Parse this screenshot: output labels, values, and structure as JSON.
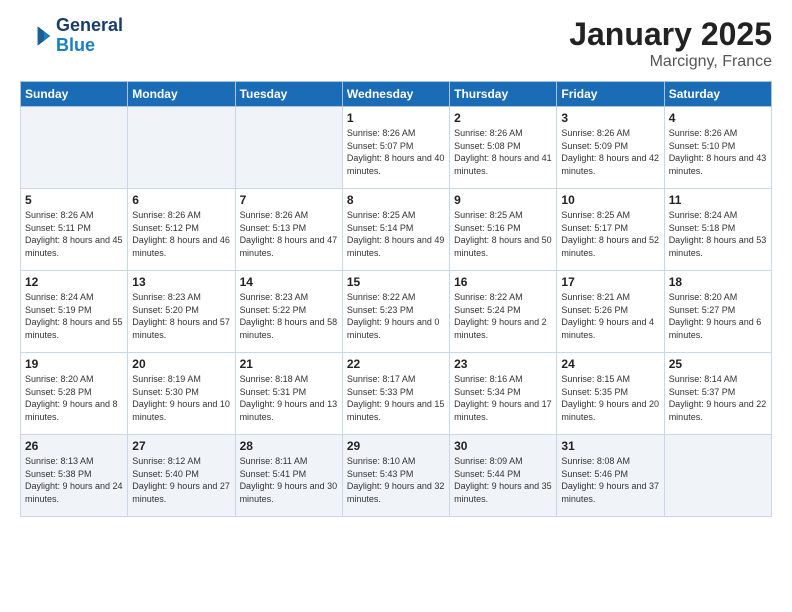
{
  "header": {
    "logo": {
      "line1": "General",
      "line2": "Blue"
    },
    "title": "January 2025",
    "location": "Marcigny, France"
  },
  "weekdays": [
    "Sunday",
    "Monday",
    "Tuesday",
    "Wednesday",
    "Thursday",
    "Friday",
    "Saturday"
  ],
  "weeks": [
    [
      {
        "day": "",
        "sunrise": "",
        "sunset": "",
        "daylight": ""
      },
      {
        "day": "",
        "sunrise": "",
        "sunset": "",
        "daylight": ""
      },
      {
        "day": "",
        "sunrise": "",
        "sunset": "",
        "daylight": ""
      },
      {
        "day": "1",
        "sunrise": "Sunrise: 8:26 AM",
        "sunset": "Sunset: 5:07 PM",
        "daylight": "Daylight: 8 hours and 40 minutes."
      },
      {
        "day": "2",
        "sunrise": "Sunrise: 8:26 AM",
        "sunset": "Sunset: 5:08 PM",
        "daylight": "Daylight: 8 hours and 41 minutes."
      },
      {
        "day": "3",
        "sunrise": "Sunrise: 8:26 AM",
        "sunset": "Sunset: 5:09 PM",
        "daylight": "Daylight: 8 hours and 42 minutes."
      },
      {
        "day": "4",
        "sunrise": "Sunrise: 8:26 AM",
        "sunset": "Sunset: 5:10 PM",
        "daylight": "Daylight: 8 hours and 43 minutes."
      }
    ],
    [
      {
        "day": "5",
        "sunrise": "Sunrise: 8:26 AM",
        "sunset": "Sunset: 5:11 PM",
        "daylight": "Daylight: 8 hours and 45 minutes."
      },
      {
        "day": "6",
        "sunrise": "Sunrise: 8:26 AM",
        "sunset": "Sunset: 5:12 PM",
        "daylight": "Daylight: 8 hours and 46 minutes."
      },
      {
        "day": "7",
        "sunrise": "Sunrise: 8:26 AM",
        "sunset": "Sunset: 5:13 PM",
        "daylight": "Daylight: 8 hours and 47 minutes."
      },
      {
        "day": "8",
        "sunrise": "Sunrise: 8:25 AM",
        "sunset": "Sunset: 5:14 PM",
        "daylight": "Daylight: 8 hours and 49 minutes."
      },
      {
        "day": "9",
        "sunrise": "Sunrise: 8:25 AM",
        "sunset": "Sunset: 5:16 PM",
        "daylight": "Daylight: 8 hours and 50 minutes."
      },
      {
        "day": "10",
        "sunrise": "Sunrise: 8:25 AM",
        "sunset": "Sunset: 5:17 PM",
        "daylight": "Daylight: 8 hours and 52 minutes."
      },
      {
        "day": "11",
        "sunrise": "Sunrise: 8:24 AM",
        "sunset": "Sunset: 5:18 PM",
        "daylight": "Daylight: 8 hours and 53 minutes."
      }
    ],
    [
      {
        "day": "12",
        "sunrise": "Sunrise: 8:24 AM",
        "sunset": "Sunset: 5:19 PM",
        "daylight": "Daylight: 8 hours and 55 minutes."
      },
      {
        "day": "13",
        "sunrise": "Sunrise: 8:23 AM",
        "sunset": "Sunset: 5:20 PM",
        "daylight": "Daylight: 8 hours and 57 minutes."
      },
      {
        "day": "14",
        "sunrise": "Sunrise: 8:23 AM",
        "sunset": "Sunset: 5:22 PM",
        "daylight": "Daylight: 8 hours and 58 minutes."
      },
      {
        "day": "15",
        "sunrise": "Sunrise: 8:22 AM",
        "sunset": "Sunset: 5:23 PM",
        "daylight": "Daylight: 9 hours and 0 minutes."
      },
      {
        "day": "16",
        "sunrise": "Sunrise: 8:22 AM",
        "sunset": "Sunset: 5:24 PM",
        "daylight": "Daylight: 9 hours and 2 minutes."
      },
      {
        "day": "17",
        "sunrise": "Sunrise: 8:21 AM",
        "sunset": "Sunset: 5:26 PM",
        "daylight": "Daylight: 9 hours and 4 minutes."
      },
      {
        "day": "18",
        "sunrise": "Sunrise: 8:20 AM",
        "sunset": "Sunset: 5:27 PM",
        "daylight": "Daylight: 9 hours and 6 minutes."
      }
    ],
    [
      {
        "day": "19",
        "sunrise": "Sunrise: 8:20 AM",
        "sunset": "Sunset: 5:28 PM",
        "daylight": "Daylight: 9 hours and 8 minutes."
      },
      {
        "day": "20",
        "sunrise": "Sunrise: 8:19 AM",
        "sunset": "Sunset: 5:30 PM",
        "daylight": "Daylight: 9 hours and 10 minutes."
      },
      {
        "day": "21",
        "sunrise": "Sunrise: 8:18 AM",
        "sunset": "Sunset: 5:31 PM",
        "daylight": "Daylight: 9 hours and 13 minutes."
      },
      {
        "day": "22",
        "sunrise": "Sunrise: 8:17 AM",
        "sunset": "Sunset: 5:33 PM",
        "daylight": "Daylight: 9 hours and 15 minutes."
      },
      {
        "day": "23",
        "sunrise": "Sunrise: 8:16 AM",
        "sunset": "Sunset: 5:34 PM",
        "daylight": "Daylight: 9 hours and 17 minutes."
      },
      {
        "day": "24",
        "sunrise": "Sunrise: 8:15 AM",
        "sunset": "Sunset: 5:35 PM",
        "daylight": "Daylight: 9 hours and 20 minutes."
      },
      {
        "day": "25",
        "sunrise": "Sunrise: 8:14 AM",
        "sunset": "Sunset: 5:37 PM",
        "daylight": "Daylight: 9 hours and 22 minutes."
      }
    ],
    [
      {
        "day": "26",
        "sunrise": "Sunrise: 8:13 AM",
        "sunset": "Sunset: 5:38 PM",
        "daylight": "Daylight: 9 hours and 24 minutes."
      },
      {
        "day": "27",
        "sunrise": "Sunrise: 8:12 AM",
        "sunset": "Sunset: 5:40 PM",
        "daylight": "Daylight: 9 hours and 27 minutes."
      },
      {
        "day": "28",
        "sunrise": "Sunrise: 8:11 AM",
        "sunset": "Sunset: 5:41 PM",
        "daylight": "Daylight: 9 hours and 30 minutes."
      },
      {
        "day": "29",
        "sunrise": "Sunrise: 8:10 AM",
        "sunset": "Sunset: 5:43 PM",
        "daylight": "Daylight: 9 hours and 32 minutes."
      },
      {
        "day": "30",
        "sunrise": "Sunrise: 8:09 AM",
        "sunset": "Sunset: 5:44 PM",
        "daylight": "Daylight: 9 hours and 35 minutes."
      },
      {
        "day": "31",
        "sunrise": "Sunrise: 8:08 AM",
        "sunset": "Sunset: 5:46 PM",
        "daylight": "Daylight: 9 hours and 37 minutes."
      },
      {
        "day": "",
        "sunrise": "",
        "sunset": "",
        "daylight": ""
      }
    ]
  ]
}
